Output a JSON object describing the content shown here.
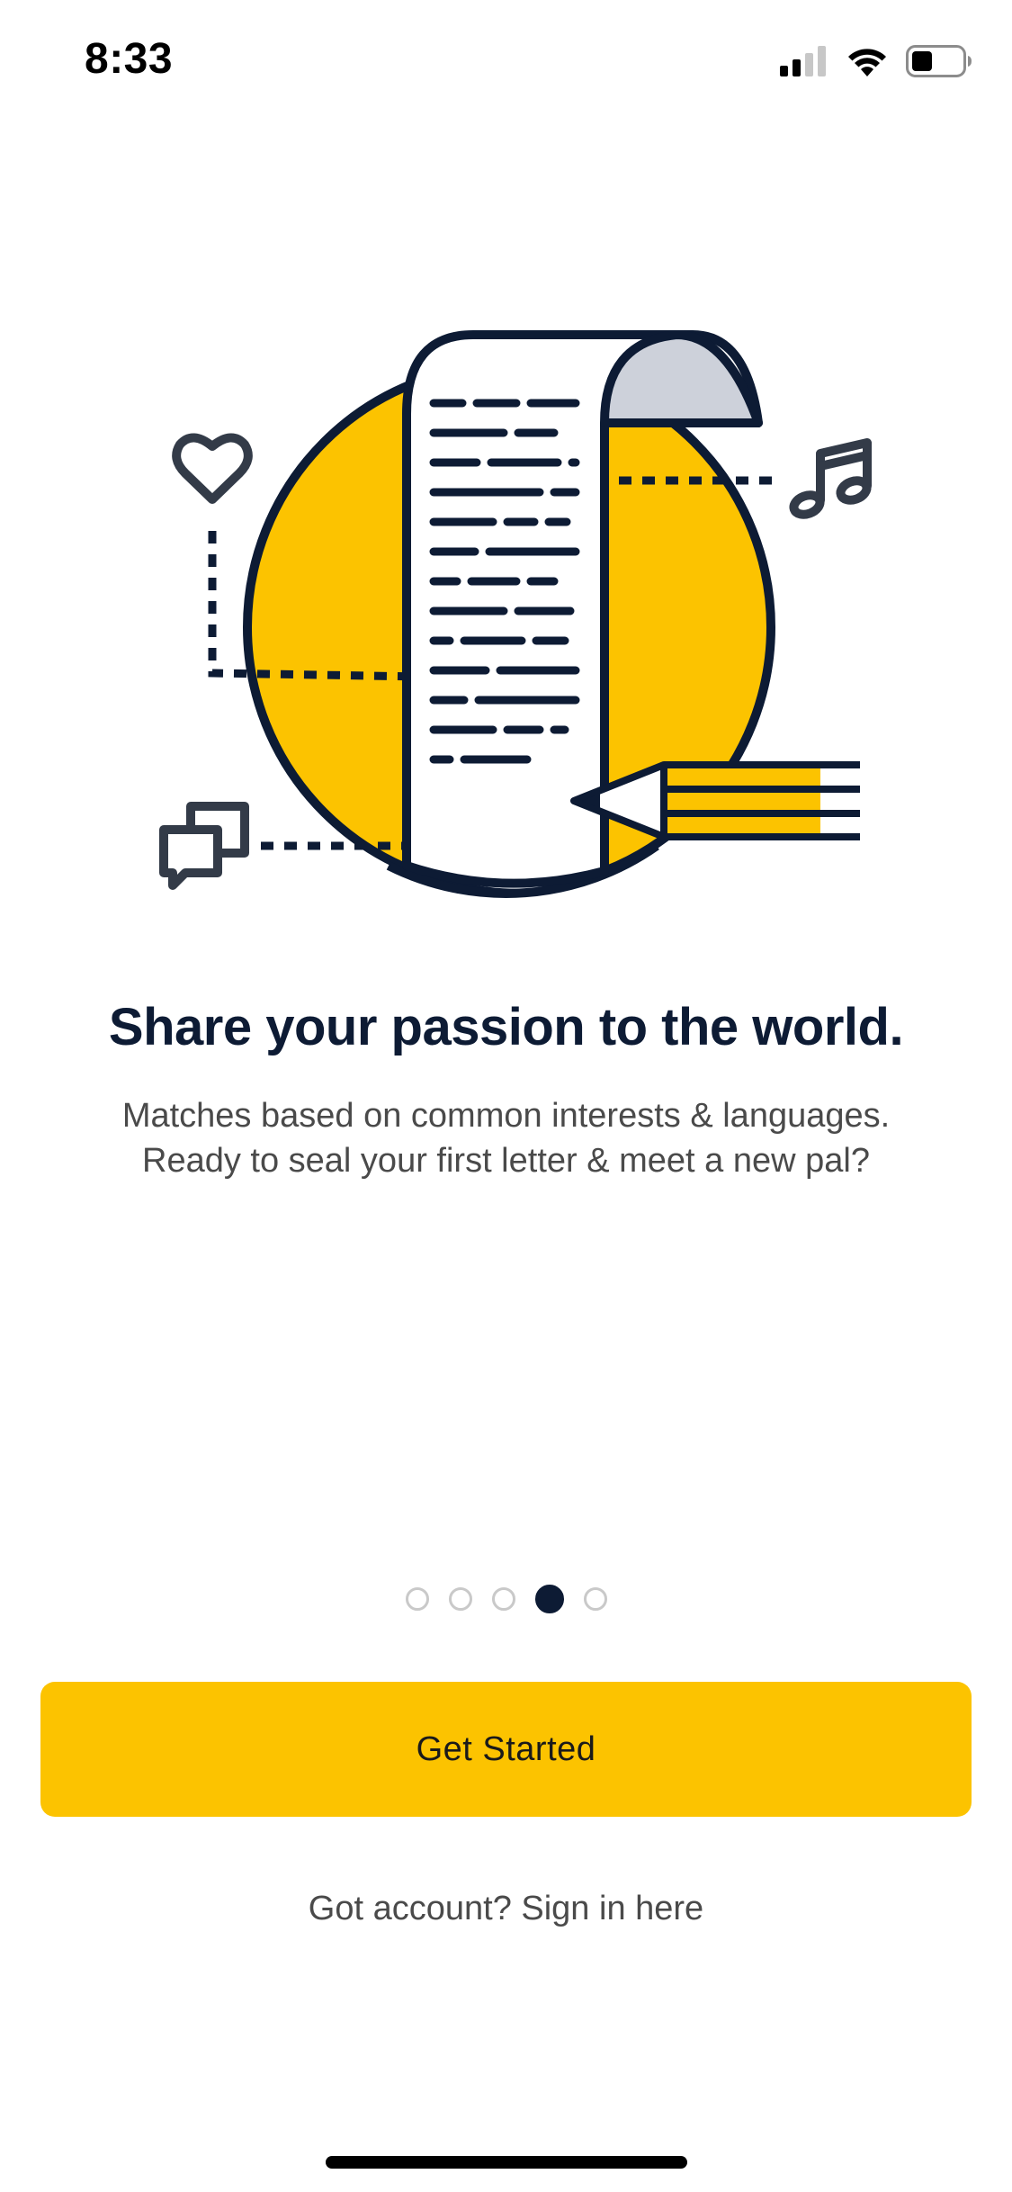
{
  "status_bar": {
    "time": "8:33",
    "icons": [
      "cellular-signal-icon",
      "wifi-icon",
      "battery-icon"
    ]
  },
  "illustration": {
    "icons": [
      "letter-scroll-icon",
      "heart-icon",
      "music-note-icon",
      "chat-bubbles-icon",
      "pencil-icon"
    ],
    "colors": {
      "accent": "#fcc300",
      "ink": "#0d1b34",
      "paper_fold": "#cdd1da"
    }
  },
  "onboarding": {
    "headline": "Share your passion to the world.",
    "subtitle_line1": "Matches based on common interests & languages.",
    "subtitle_line2": "Ready to seal your first letter & meet a new pal?"
  },
  "pager": {
    "total_pages": 5,
    "current_page": 4
  },
  "actions": {
    "primary_label": "Get Started",
    "signin_label": "Got account? Sign in here"
  },
  "colors": {
    "brand_yellow": "#fcc300",
    "navy": "#0d1b34",
    "text_gray": "#4a4a4a"
  }
}
